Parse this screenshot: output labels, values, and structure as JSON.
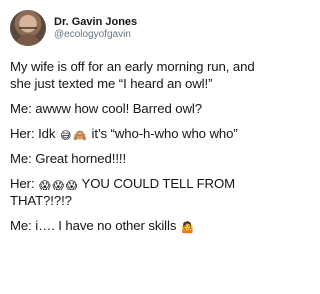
{
  "tweet": {
    "author": {
      "display_name": "Dr. Gavin Jones",
      "handle": "@ecologyofgavin"
    },
    "lines": [
      {
        "text": "My wife is off for an early morning run, and she just texted me “I heard an owl!”"
      },
      {
        "text": "Me: awww how cool! Barred owl?"
      },
      {
        "prefix": "Her: Idk",
        "emojis": [
          "😅",
          "🙈"
        ],
        "suffix": "it’s “who-h-who  who who”"
      },
      {
        "text": "Me: Great horned!!!!"
      },
      {
        "prefix": "Her:",
        "emojis": [
          "😱",
          "😱",
          "😱"
        ],
        "suffix": "YOU COULD TELL FROM THAT?!?!?"
      },
      {
        "prefix": "Me: i…. I have no other skills",
        "emojis": [
          "🤷"
        ],
        "suffix": ""
      }
    ]
  }
}
